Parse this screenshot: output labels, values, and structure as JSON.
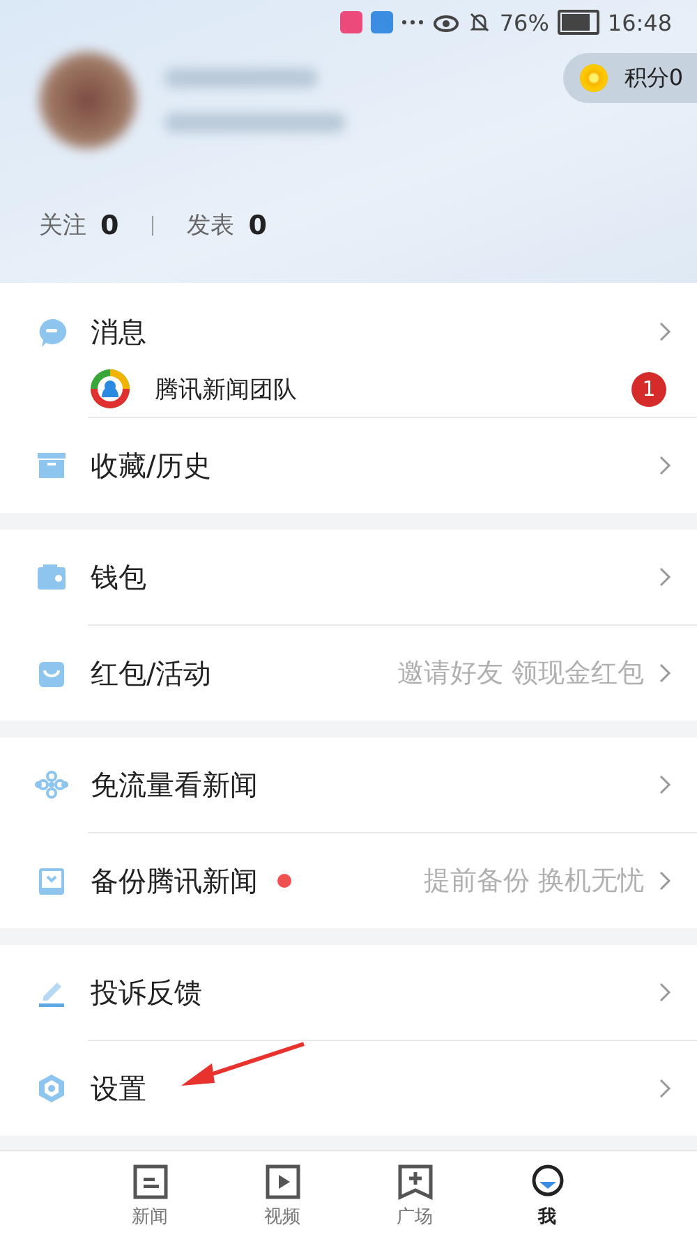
{
  "status_bar": {
    "battery": "76%",
    "time": "16:48"
  },
  "profile": {
    "points": "积分0",
    "stats": [
      {
        "label": "关注",
        "value": "0"
      },
      {
        "label": "发表",
        "value": "0"
      }
    ]
  },
  "sections": [
    {
      "items": [
        {
          "kind": "message",
          "label": "消息",
          "sender": "腾讯新闻团队",
          "badge": "1"
        },
        {
          "kind": "link",
          "label": "收藏/历史"
        }
      ]
    },
    {
      "items": [
        {
          "kind": "link",
          "label": "钱包"
        },
        {
          "kind": "link",
          "label": "红包/活动",
          "hint": "邀请好友 领现金红包"
        }
      ]
    },
    {
      "items": [
        {
          "kind": "link",
          "label": "免流量看新闻"
        },
        {
          "kind": "link",
          "label": "备份腾讯新闻",
          "dot": true,
          "hint": "提前备份 换机无忧"
        }
      ]
    },
    {
      "items": [
        {
          "kind": "link",
          "label": "投诉反馈"
        },
        {
          "kind": "link",
          "label": "设置"
        }
      ]
    }
  ],
  "tabs": [
    {
      "label": "新闻",
      "selected": false
    },
    {
      "label": "视频",
      "selected": false
    },
    {
      "label": "广场",
      "selected": false
    },
    {
      "label": "我",
      "selected": true
    }
  ]
}
